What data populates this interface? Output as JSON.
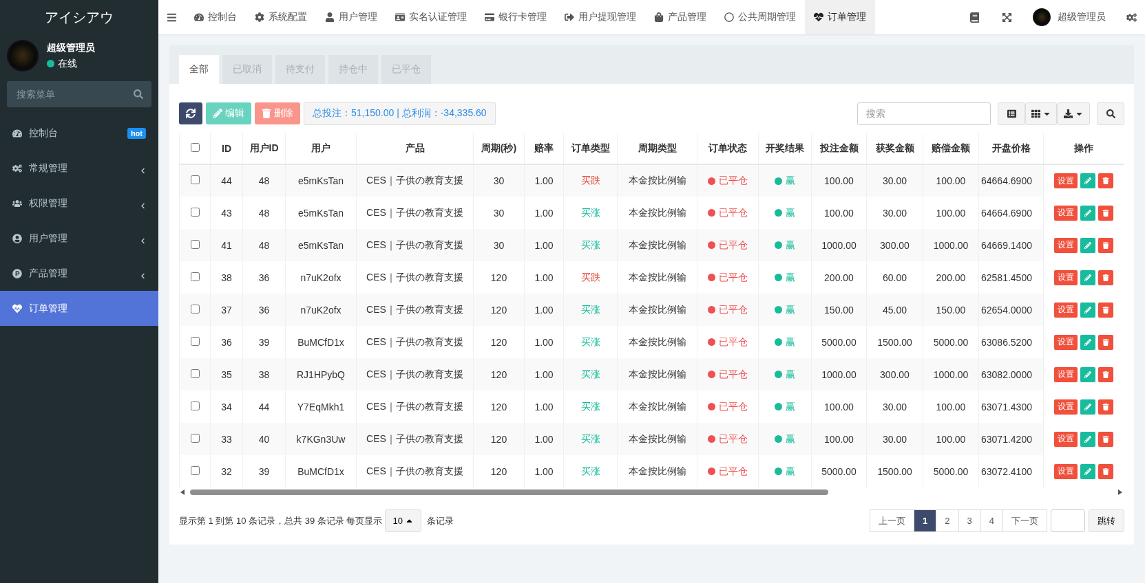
{
  "sidebar": {
    "brand": "アイシアウ",
    "user": {
      "name": "超级管理员",
      "status": "在线"
    },
    "search": {
      "placeholder": "搜索菜单"
    },
    "items": [
      {
        "label": "控制台",
        "badge": "hot",
        "expandable": false,
        "selected": false
      },
      {
        "label": "常规管理",
        "expandable": true,
        "selected": false
      },
      {
        "label": "权限管理",
        "expandable": true,
        "selected": false
      },
      {
        "label": "用户管理",
        "expandable": true,
        "selected": false
      },
      {
        "label": "产品管理",
        "expandable": true,
        "selected": false
      },
      {
        "label": "订单管理",
        "expandable": false,
        "selected": true
      }
    ]
  },
  "topnav": {
    "items": [
      {
        "label": "控制台",
        "selected": false
      },
      {
        "label": "系统配置",
        "selected": false
      },
      {
        "label": "用户管理",
        "selected": false
      },
      {
        "label": "实名认证管理",
        "selected": false
      },
      {
        "label": "银行卡管理",
        "selected": false
      },
      {
        "label": "用户提现管理",
        "selected": false
      },
      {
        "label": "产品管理",
        "selected": false
      },
      {
        "label": "公共周期管理",
        "selected": false
      },
      {
        "label": "订单管理",
        "selected": true
      }
    ],
    "user": "超级管理员"
  },
  "tabs": [
    {
      "label": "全部",
      "selected": true
    },
    {
      "label": "已取消",
      "selected": false
    },
    {
      "label": "待支付",
      "selected": false
    },
    {
      "label": "持仓中",
      "selected": false
    },
    {
      "label": "已平仓",
      "selected": false
    }
  ],
  "toolbar": {
    "edit": {
      "label": "编辑",
      "disabled": true
    },
    "delete": {
      "label": "删除",
      "disabled": true
    },
    "summary": "总投注：51,150.00 | 总利润：-34,335.60",
    "search": {
      "placeholder": "搜索"
    }
  },
  "table": {
    "select_all": {
      "checked": false
    },
    "columns": [
      "ID",
      "用户ID",
      "用户",
      "产品",
      "周期(秒)",
      "赔率",
      "订单类型",
      "周期类型",
      "订单状态",
      "开奖结果",
      "投注金额",
      "获奖金额",
      "赔偿金额",
      "开盘价格",
      "操作"
    ],
    "rows": [
      {
        "checked": false,
        "id": "44",
        "user_id": "48",
        "user": "e5mKsTan",
        "product": "CES｜子供の教育支援",
        "period": "30",
        "odds": "1.00",
        "order_type": {
          "text": "买跌",
          "color": "#e74c3c"
        },
        "period_type": "本金按比例输",
        "status": {
          "text": "已平仓",
          "color": "#f05050"
        },
        "result": {
          "text": "赢",
          "color": "#18bc9c"
        },
        "bet": "100.00",
        "prize": "30.00",
        "compensation": "100.00",
        "open_price": "64664.6900",
        "action": "设置"
      },
      {
        "checked": false,
        "id": "43",
        "user_id": "48",
        "user": "e5mKsTan",
        "product": "CES｜子供の教育支援",
        "period": "30",
        "odds": "1.00",
        "order_type": {
          "text": "买涨",
          "color": "#18bc9c"
        },
        "period_type": "本金按比例输",
        "status": {
          "text": "已平仓",
          "color": "#f05050"
        },
        "result": {
          "text": "赢",
          "color": "#18bc9c"
        },
        "bet": "100.00",
        "prize": "30.00",
        "compensation": "100.00",
        "open_price": "64664.6900",
        "action": "设置"
      },
      {
        "checked": false,
        "id": "41",
        "user_id": "48",
        "user": "e5mKsTan",
        "product": "CES｜子供の教育支援",
        "period": "30",
        "odds": "1.00",
        "order_type": {
          "text": "买涨",
          "color": "#18bc9c"
        },
        "period_type": "本金按比例输",
        "status": {
          "text": "已平仓",
          "color": "#f05050"
        },
        "result": {
          "text": "赢",
          "color": "#18bc9c"
        },
        "bet": "1000.00",
        "prize": "300.00",
        "compensation": "1000.00",
        "open_price": "64669.1400",
        "action": "设置"
      },
      {
        "checked": false,
        "id": "38",
        "user_id": "36",
        "user": "n7uK2ofx",
        "product": "CES｜子供の教育支援",
        "period": "120",
        "odds": "1.00",
        "order_type": {
          "text": "买跌",
          "color": "#e74c3c"
        },
        "period_type": "本金按比例输",
        "status": {
          "text": "已平仓",
          "color": "#f05050"
        },
        "result": {
          "text": "赢",
          "color": "#18bc9c"
        },
        "bet": "200.00",
        "prize": "60.00",
        "compensation": "200.00",
        "open_price": "62581.4500",
        "action": "设置"
      },
      {
        "checked": false,
        "id": "37",
        "user_id": "36",
        "user": "n7uK2ofx",
        "product": "CES｜子供の教育支援",
        "period": "120",
        "odds": "1.00",
        "order_type": {
          "text": "买涨",
          "color": "#18bc9c"
        },
        "period_type": "本金按比例输",
        "status": {
          "text": "已平仓",
          "color": "#f05050"
        },
        "result": {
          "text": "赢",
          "color": "#18bc9c"
        },
        "bet": "150.00",
        "prize": "45.00",
        "compensation": "150.00",
        "open_price": "62654.0000",
        "action": "设置"
      },
      {
        "checked": false,
        "id": "36",
        "user_id": "39",
        "user": "BuMCfD1x",
        "product": "CES｜子供の教育支援",
        "period": "120",
        "odds": "1.00",
        "order_type": {
          "text": "买涨",
          "color": "#18bc9c"
        },
        "period_type": "本金按比例输",
        "status": {
          "text": "已平仓",
          "color": "#f05050"
        },
        "result": {
          "text": "赢",
          "color": "#18bc9c"
        },
        "bet": "5000.00",
        "prize": "1500.00",
        "compensation": "5000.00",
        "open_price": "63086.5200",
        "action": "设置"
      },
      {
        "checked": false,
        "id": "35",
        "user_id": "38",
        "user": "RJ1HPybQ",
        "product": "CES｜子供の教育支援",
        "period": "120",
        "odds": "1.00",
        "order_type": {
          "text": "买涨",
          "color": "#18bc9c"
        },
        "period_type": "本金按比例输",
        "status": {
          "text": "已平仓",
          "color": "#f05050"
        },
        "result": {
          "text": "赢",
          "color": "#18bc9c"
        },
        "bet": "1000.00",
        "prize": "300.00",
        "compensation": "1000.00",
        "open_price": "63082.0000",
        "action": "设置"
      },
      {
        "checked": false,
        "id": "34",
        "user_id": "44",
        "user": "Y7EqMkh1",
        "product": "CES｜子供の教育支援",
        "period": "120",
        "odds": "1.00",
        "order_type": {
          "text": "买涨",
          "color": "#18bc9c"
        },
        "period_type": "本金按比例输",
        "status": {
          "text": "已平仓",
          "color": "#f05050"
        },
        "result": {
          "text": "赢",
          "color": "#18bc9c"
        },
        "bet": "100.00",
        "prize": "30.00",
        "compensation": "100.00",
        "open_price": "63071.4300",
        "action": "设置"
      },
      {
        "checked": false,
        "id": "33",
        "user_id": "40",
        "user": "k7KGn3Uw",
        "product": "CES｜子供の教育支援",
        "period": "120",
        "odds": "1.00",
        "order_type": {
          "text": "买涨",
          "color": "#18bc9c"
        },
        "period_type": "本金按比例输",
        "status": {
          "text": "已平仓",
          "color": "#f05050"
        },
        "result": {
          "text": "赢",
          "color": "#18bc9c"
        },
        "bet": "100.00",
        "prize": "30.00",
        "compensation": "100.00",
        "open_price": "63071.4200",
        "action": "设置"
      },
      {
        "checked": false,
        "id": "32",
        "user_id": "39",
        "user": "BuMCfD1x",
        "product": "CES｜子供の教育支援",
        "period": "120",
        "odds": "1.00",
        "order_type": {
          "text": "买涨",
          "color": "#18bc9c"
        },
        "period_type": "本金按比例输",
        "status": {
          "text": "已平仓",
          "color": "#f05050"
        },
        "result": {
          "text": "赢",
          "color": "#18bc9c"
        },
        "bet": "5000.00",
        "prize": "1500.00",
        "compensation": "5000.00",
        "open_price": "63072.4100",
        "action": "设置"
      }
    ]
  },
  "pagination": {
    "info": "显示第 1 到第 10 条记录，总共 39 条记录 每页显示",
    "page_size": "10",
    "suffix": "条记录",
    "prev": "上一页",
    "pages": [
      {
        "label": "1",
        "selected": true
      },
      {
        "label": "2",
        "selected": false
      },
      {
        "label": "3",
        "selected": false
      },
      {
        "label": "4",
        "selected": false
      }
    ],
    "next": "下一页",
    "jump": "跳转"
  }
}
